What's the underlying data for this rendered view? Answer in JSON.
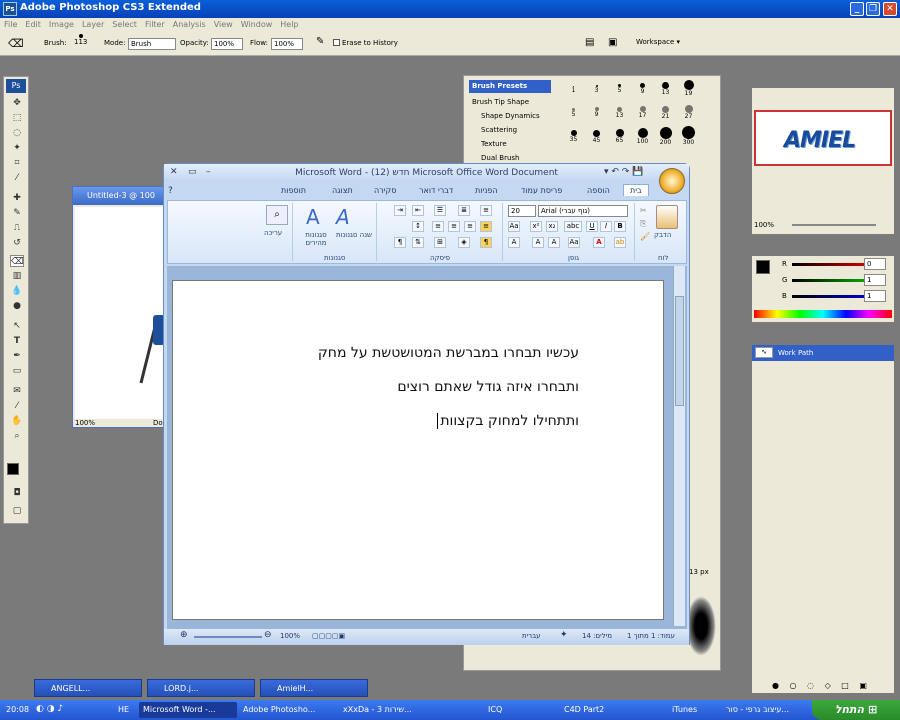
{
  "photoshop": {
    "title": "Adobe Photoshop CS3 Extended",
    "menu": [
      "File",
      "Edit",
      "Image",
      "Layer",
      "Select",
      "Filter",
      "Analysis",
      "View",
      "Window",
      "Help"
    ],
    "options": {
      "brush_label": "Brush:",
      "brush_size": "113",
      "mode_label": "Mode:",
      "mode_value": "Brush",
      "opacity_label": "Opacity:",
      "opacity_value": "100%",
      "flow_label": "Flow:",
      "flow_value": "100%",
      "erase_history": "Erase to History",
      "workspace": "Workspace"
    },
    "doc": {
      "title": "Untitled-3 @ 100",
      "zoom": "100%",
      "status": "Doc"
    },
    "brushes": {
      "items": [
        "Brush Presets",
        "Brush Tip Shape",
        "Shape Dynamics",
        "Scattering",
        "Texture",
        "Dual Brush"
      ],
      "sizes_row1": [
        "1",
        "3",
        "5",
        "9",
        "13",
        "19"
      ],
      "sizes_row2": [
        "5",
        "9",
        "13",
        "17",
        "21",
        "27"
      ],
      "sizes_row3": [
        "35",
        "45",
        "65",
        "100",
        "200",
        "300"
      ],
      "px_value": "13 px"
    },
    "navigator": {
      "zoom": "100%",
      "logo_text": "AMIEL"
    },
    "color": {
      "r_label": "R",
      "g_label": "G",
      "b_label": "B",
      "r": "0",
      "g": "1",
      "b": "1"
    },
    "paths": {
      "item": "Work Path"
    }
  },
  "word": {
    "title": "Microsoft Word - חדש (12) Microsoft Office Word Document",
    "tabs": [
      "בית",
      "הוספה",
      "פריסת עמוד",
      "הפניות",
      "דברי דואר",
      "סקירה",
      "תצוגה",
      "תוספות"
    ],
    "ribbon": {
      "font_name": "Arial (גוף עברי)",
      "font_size": "20",
      "paste_label": "הדבק",
      "clipboard_label": "לוח",
      "font_group_label": "גופן",
      "paragraph_group_label": "פיסקה",
      "styles_group_label": "סגנונות",
      "quick_styles_label": "סגנונות מהירים",
      "change_styles_label": "שנה סגנונות",
      "editing_label": "עריכה"
    },
    "lines": [
      "עכשיו תבחרו במברשת המטושטשת על מחק",
      "ותבחרו איזה גודל שאתם רוצים",
      "ותתחילו למחוק בקצוות"
    ],
    "status": {
      "page": "עמוד: 1 מתוך 1",
      "words": "מילים: 14",
      "language": "עברית",
      "zoom": "100%"
    }
  },
  "mini_windows": [
    "ANGELL...",
    "LORD.j...",
    "AmielH..."
  ],
  "taskbar": {
    "clock": "20:08",
    "lang": "HE",
    "tasks": [
      "Microsoft Word -...",
      "Adobe Photosho...",
      "xXxDa - 3 שירות...",
      "ICQ",
      "C4D Part2",
      "iTunes",
      "עיצוב גרפי - סור..."
    ],
    "start_label": "התחל"
  },
  "colors": {
    "xp_blue": "#2455d0",
    "ribbon_blue": "#c4d8f2",
    "start_green": "#2a8a2a"
  }
}
